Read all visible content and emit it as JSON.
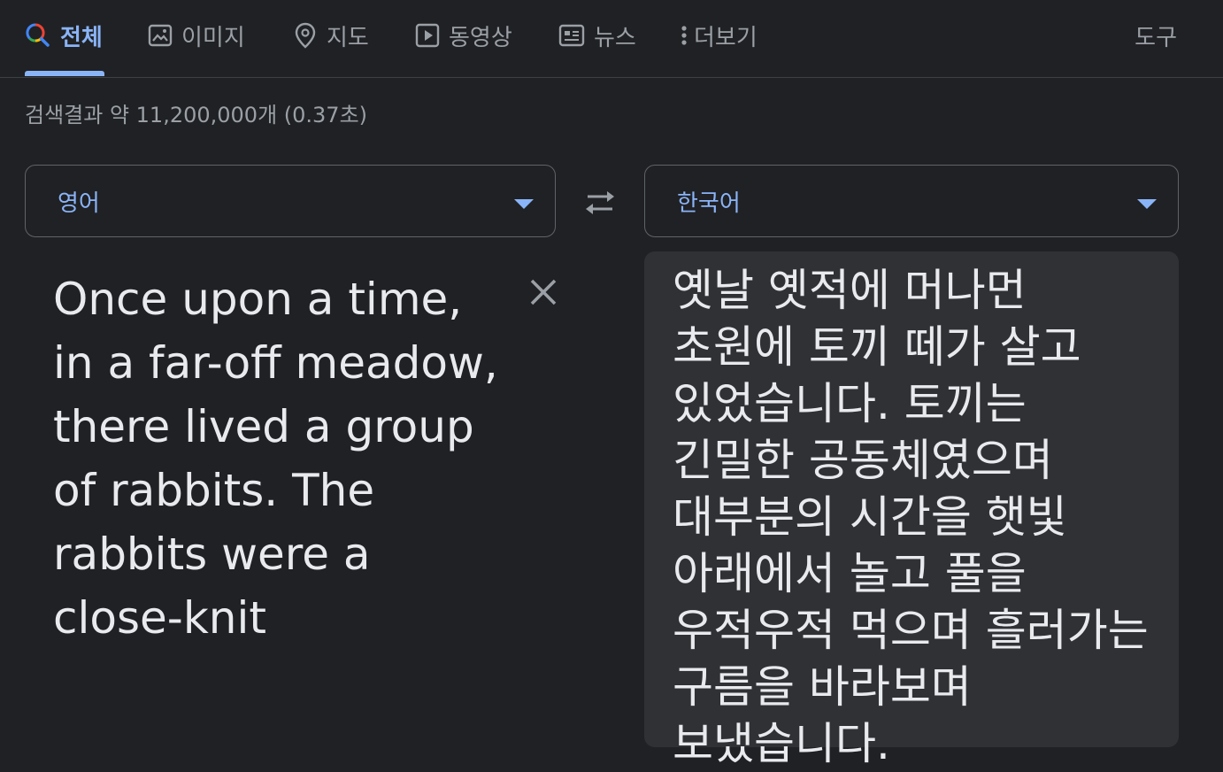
{
  "nav": {
    "tabs": [
      {
        "label": "전체",
        "icon": "search-icon",
        "active": true
      },
      {
        "label": "이미지",
        "icon": "image-icon",
        "active": false
      },
      {
        "label": "지도",
        "icon": "map-pin-icon",
        "active": false
      },
      {
        "label": "동영상",
        "icon": "video-play-icon",
        "active": false
      },
      {
        "label": "뉴스",
        "icon": "news-icon",
        "active": false
      },
      {
        "label": "더보기",
        "icon": "more-vert-icon",
        "active": false
      }
    ],
    "tools_label": "도구"
  },
  "results_stats": "검색결과 약 11,200,000개 (0.37초)",
  "translator": {
    "source_language": "영어",
    "target_language": "한국어",
    "source_text": "Once upon a time, in a far-off meadow, there lived a group of rabbits. The rabbits were a close-knit",
    "target_text": "옛날 옛적에 머나먼 초원에 토끼 떼가 살고 있었습니다. 토끼는 긴밀한 공동체였으며 대부분의 시간을 햇빛 아래에서 놀고 풀을 우적우적 먹으며 흘러가는 구름을 바라보며 보냈습니다."
  },
  "colors": {
    "background": "#202124",
    "accent": "#8ab4f8",
    "panel": "#303134",
    "text": "#e8eaed",
    "muted": "#9aa0a6"
  }
}
